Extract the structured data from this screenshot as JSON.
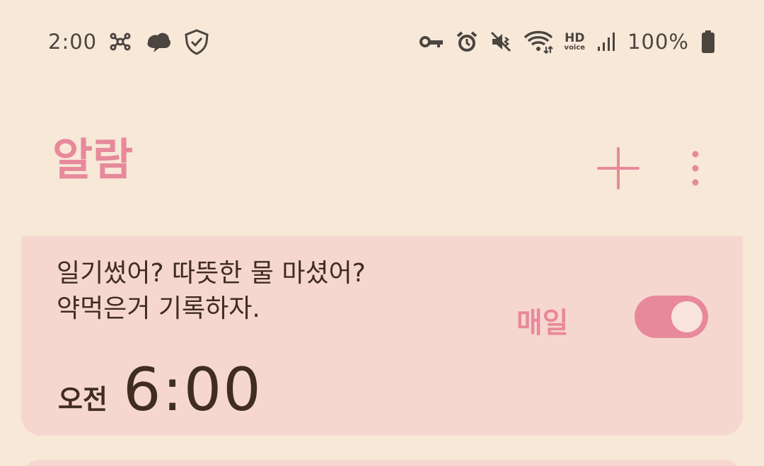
{
  "status_bar": {
    "time": "2:00",
    "battery_percent": "100%",
    "hd": "HD",
    "voice": "voice",
    "icons": [
      "notification-app-icon",
      "cloud-app-icon",
      "shield-check-icon",
      "vpn-key-icon",
      "alarm-icon",
      "vibrate-mute-icon",
      "wifi-icon",
      "hd-voice-icon",
      "signal-icon",
      "battery-icon"
    ]
  },
  "header": {
    "title": "알람",
    "add_icon": "plus-icon",
    "more_icon": "more-vertical-icon"
  },
  "alarms": [
    {
      "label": "일기썼어? 따뜻한 물 마셨어?\n약먹은거 기록하자.",
      "ampm": "오전",
      "time": "6:00",
      "repeat": "매일",
      "enabled": true
    }
  ],
  "colors": {
    "background": "#f7e8d8",
    "card": "#f6d7d0",
    "accent": "#e8899b",
    "text": "#3f2d20"
  }
}
